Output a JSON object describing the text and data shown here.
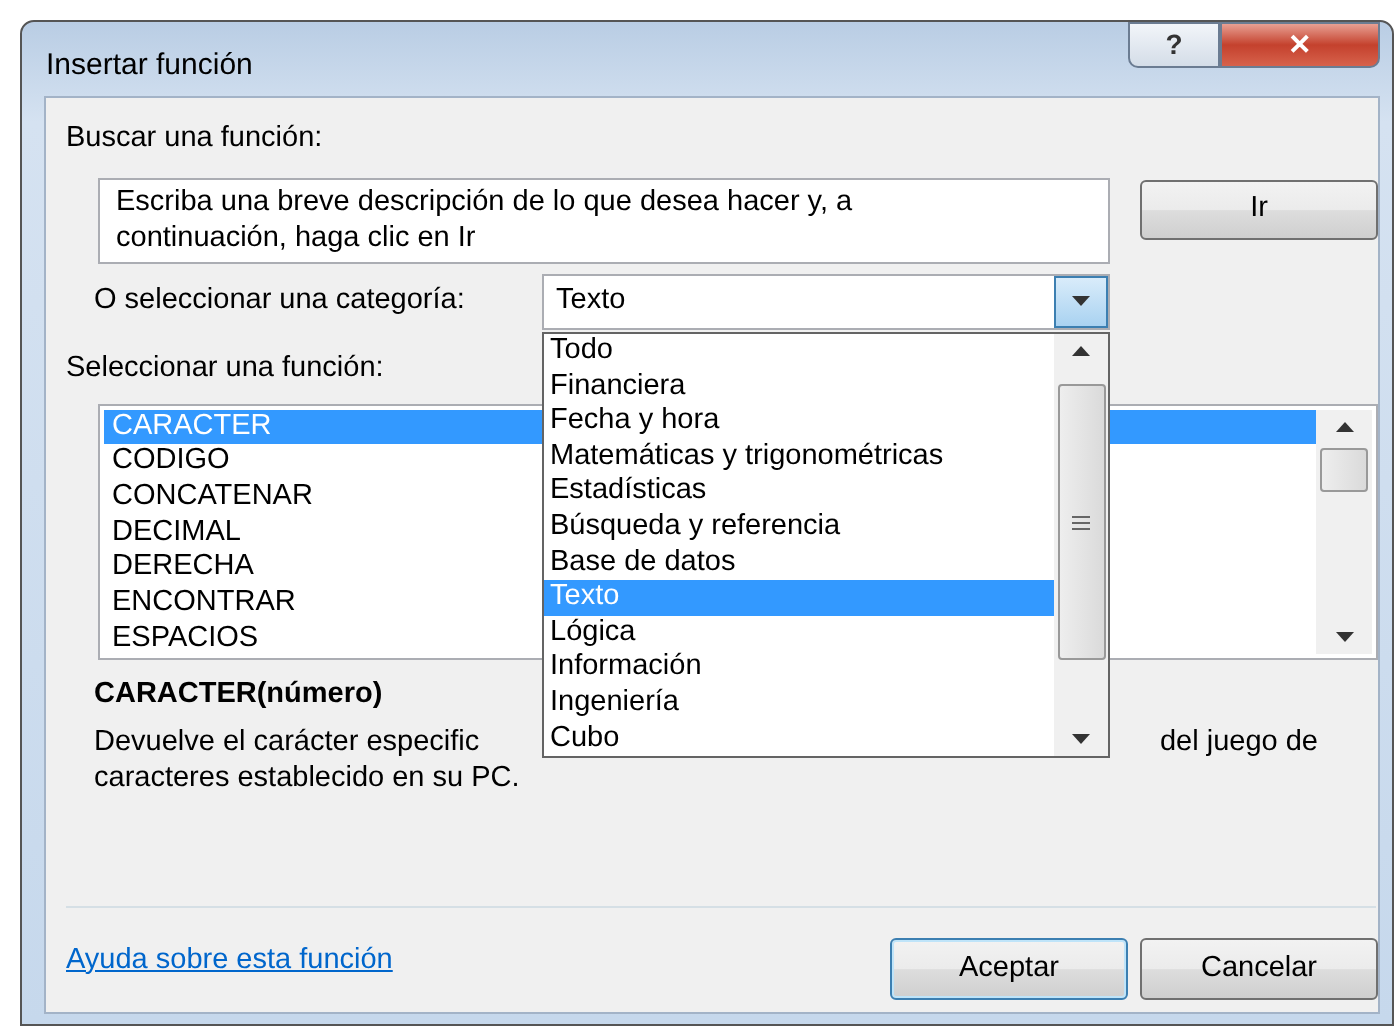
{
  "window": {
    "title": "Insertar función",
    "help_button": "?",
    "close_button": "✕"
  },
  "search": {
    "label": "Buscar una función:",
    "value": "Escriba una breve descripción de lo que desea hacer y, a continuación, haga clic en Ir",
    "go_button": "Ir"
  },
  "category": {
    "label": "O seleccionar una categoría:",
    "value": "Texto",
    "expanded": true,
    "options": [
      {
        "label": "Todo",
        "selected": false
      },
      {
        "label": "Financiera",
        "selected": false
      },
      {
        "label": "Fecha y hora",
        "selected": false
      },
      {
        "label": "Matemáticas y trigonométricas",
        "selected": false
      },
      {
        "label": "Estadísticas",
        "selected": false
      },
      {
        "label": "Búsqueda y referencia",
        "selected": false
      },
      {
        "label": "Base de datos",
        "selected": false
      },
      {
        "label": "Texto",
        "selected": true
      },
      {
        "label": "Lógica",
        "selected": false
      },
      {
        "label": "Información",
        "selected": false
      },
      {
        "label": "Ingeniería",
        "selected": false
      },
      {
        "label": "Cubo",
        "selected": false
      }
    ]
  },
  "functions": {
    "label": "Seleccionar una función:",
    "items": [
      {
        "label": "CARACTER",
        "selected": true
      },
      {
        "label": "CODIGO",
        "selected": false
      },
      {
        "label": "CONCATENAR",
        "selected": false
      },
      {
        "label": "DECIMAL",
        "selected": false
      },
      {
        "label": "DERECHA",
        "selected": false
      },
      {
        "label": "ENCONTRAR",
        "selected": false
      },
      {
        "label": "ESPACIOS",
        "selected": false
      }
    ]
  },
  "details": {
    "signature": "CARACTER(número)",
    "description_line_1_start": "Devuelve el carácter especific",
    "description_line_1_end": "del juego de",
    "description_line_2": "caracteres establecido en su PC."
  },
  "footer": {
    "help_link": "Ayuda sobre esta función",
    "buttons": [
      {
        "label": "Aceptar",
        "kind": "default"
      },
      {
        "label": "Cancelar",
        "kind": "normal"
      }
    ]
  }
}
